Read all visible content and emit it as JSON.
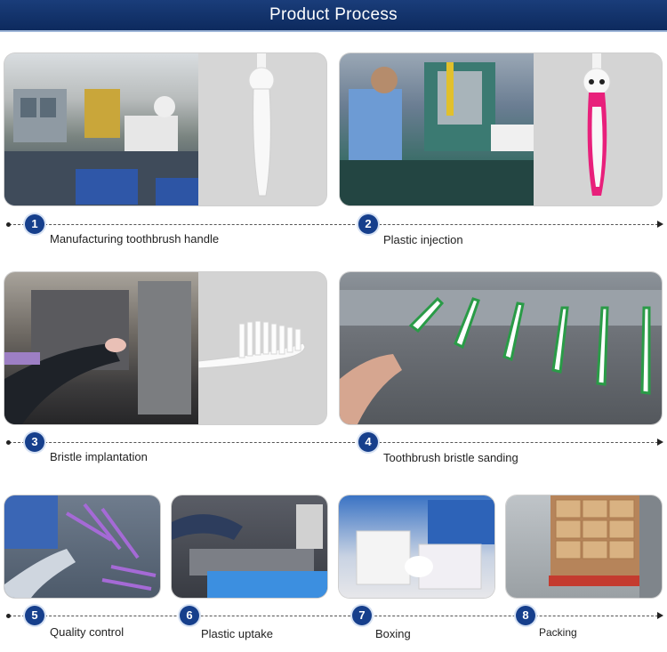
{
  "header": {
    "title": "Product Process"
  },
  "steps": [
    {
      "number": "1",
      "label": "Manufacturing toothbrush handle"
    },
    {
      "number": "2",
      "label": "Plastic injection"
    },
    {
      "number": "3",
      "label": "Bristle implantation"
    },
    {
      "number": "4",
      "label": "Toothbrush bristle sanding"
    },
    {
      "number": "5",
      "label": "Quality control"
    },
    {
      "number": "6",
      "label": "Plastic uptake"
    },
    {
      "number": "7",
      "label": "Boxing"
    },
    {
      "number": "8",
      "label": "Packing"
    }
  ],
  "colors": {
    "banner": "#0d2a5e",
    "step_badge": "#163f8c"
  }
}
